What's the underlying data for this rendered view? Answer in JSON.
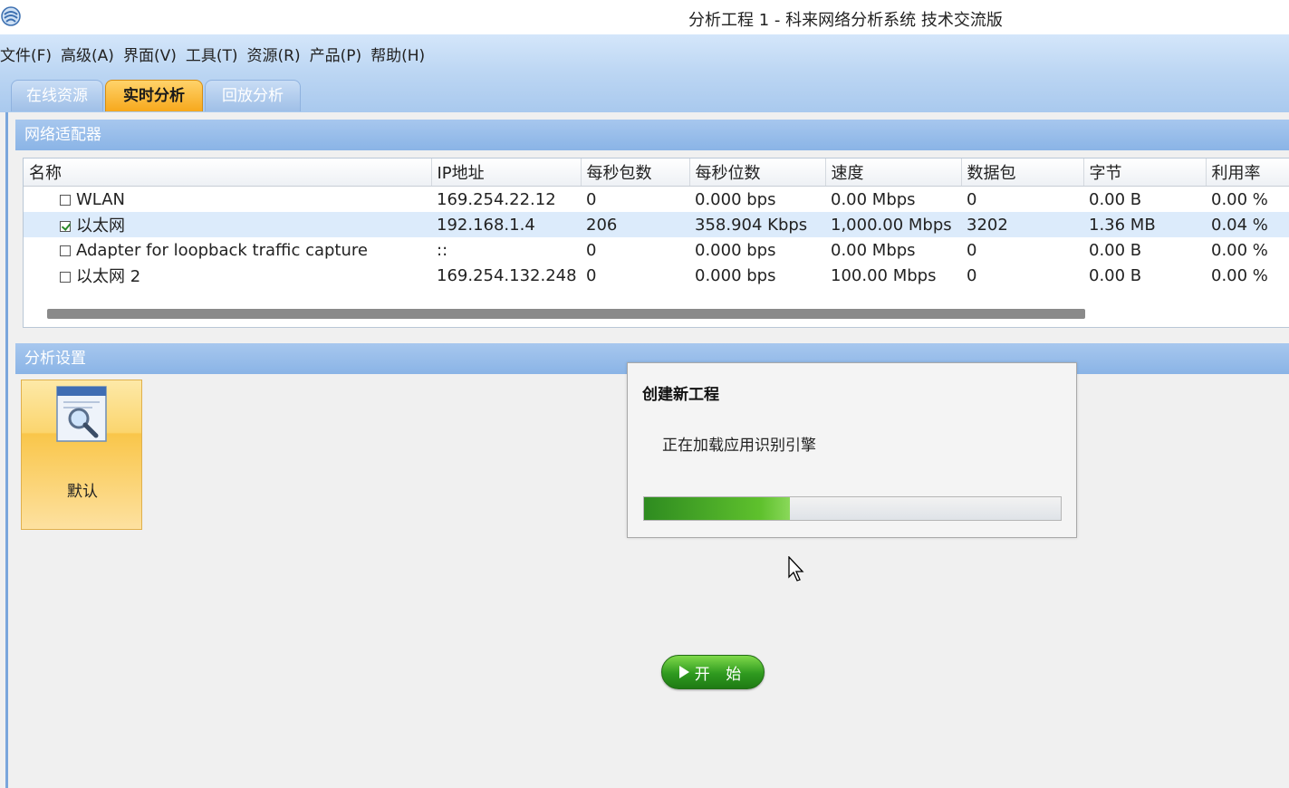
{
  "window": {
    "title": "分析工程 1 - 科来网络分析系统 技术交流版"
  },
  "menu": {
    "items": [
      "文件(F)",
      "高级(A)",
      "界面(V)",
      "工具(T)",
      "资源(R)",
      "产品(P)",
      "帮助(H)"
    ]
  },
  "tabs": [
    {
      "label": "在线资源",
      "active": false
    },
    {
      "label": "实时分析",
      "active": true
    },
    {
      "label": "回放分析",
      "active": false
    }
  ],
  "adapters": {
    "section_title": "网络适配器",
    "columns": [
      "名称",
      "IP地址",
      "每秒包数",
      "每秒位数",
      "速度",
      "数据包",
      "字节",
      "利用率"
    ],
    "rows": [
      {
        "checked": false,
        "name": "WLAN",
        "ip": "169.254.22.12",
        "pps": "0",
        "bps": "0.000 bps",
        "speed": "0.00 Mbps",
        "packets": "0",
        "bytes": "0.00 B",
        "util": "0.00 %"
      },
      {
        "checked": true,
        "name": "以太网",
        "ip": "192.168.1.4",
        "pps": "206",
        "bps": "358.904 Kbps",
        "speed": "1,000.00 Mbps",
        "packets": "3202",
        "bytes": "1.36 MB",
        "util": "0.04 %"
      },
      {
        "checked": false,
        "name": "Adapter for loopback traffic capture",
        "ip": "::",
        "pps": "0",
        "bps": "0.000 bps",
        "speed": "0.00 Mbps",
        "packets": "0",
        "bytes": "0.00 B",
        "util": "0.00 %"
      },
      {
        "checked": false,
        "name": "以太网 2",
        "ip": "169.254.132.248",
        "pps": "0",
        "bps": "0.000 bps",
        "speed": "100.00 Mbps",
        "packets": "0",
        "bytes": "0.00 B",
        "util": "0.00 %"
      }
    ]
  },
  "analysis": {
    "section_title": "分析设置",
    "profile_label": "默认"
  },
  "dialog": {
    "title": "创建新工程",
    "message": "正在加载应用识别引擎",
    "progress_fraction": 0.35
  },
  "start_button": {
    "label": "开 始"
  },
  "colors": {
    "menu_bar": "#c8dcf5",
    "section_header": "#8ab4e6",
    "active_tab": "#f7a81c",
    "selected_row": "#dcebfb",
    "progress_fill": "#4caf2a",
    "start_button": "#2f9a1f"
  },
  "icons": {
    "app_logo": "colasoft-logo-icon",
    "profile_icon": "magnifier-document-icon",
    "start_icon": "play-icon",
    "cursor": "mouse-pointer-icon"
  }
}
